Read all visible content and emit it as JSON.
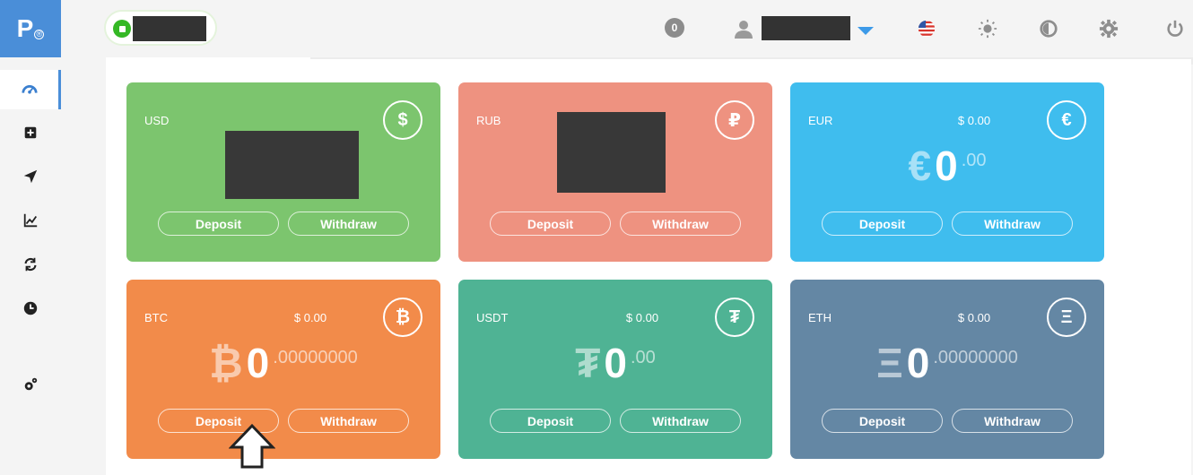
{
  "logo": {
    "letter": "P",
    "mark": "®"
  },
  "sidebar": {
    "items": [
      {
        "name": "dashboard",
        "icon": "gauge-icon",
        "active": true
      },
      {
        "name": "add",
        "icon": "plus-square-icon",
        "active": false
      },
      {
        "name": "send",
        "icon": "paper-plane-icon",
        "active": false
      },
      {
        "name": "stats",
        "icon": "line-chart-icon",
        "active": false
      },
      {
        "name": "exchange",
        "icon": "refresh-icon",
        "active": false
      },
      {
        "name": "history",
        "icon": "clock-icon",
        "active": false
      },
      {
        "name": "settings",
        "icon": "cogs-icon",
        "active": false
      }
    ]
  },
  "header": {
    "notification_count": "0",
    "icons": [
      "us-flag-icon",
      "sun-icon",
      "theme-icon",
      "gear-icon",
      "power-icon"
    ]
  },
  "cards": [
    {
      "currency": "USD",
      "usd_value": "",
      "symbol": "$",
      "amount_int": "",
      "amount_dec": "",
      "color": "#7cc56e",
      "deposit": "Deposit",
      "withdraw": "Withdraw",
      "redacted": true
    },
    {
      "currency": "RUB",
      "usd_value": "",
      "symbol": "₽",
      "amount_int": "",
      "amount_dec": "",
      "color": "#ee9280",
      "deposit": "Deposit",
      "withdraw": "Withdraw",
      "redacted": true
    },
    {
      "currency": "EUR",
      "usd_value": "$ 0.00",
      "symbol": "€",
      "amount_int": "0",
      "amount_dec": ".00",
      "color": "#3fbdee",
      "deposit": "Deposit",
      "withdraw": "Withdraw"
    },
    {
      "currency": "BTC",
      "usd_value": "$ 0.00",
      "symbol": "₿",
      "amount_int": "0",
      "amount_dec": ".00000000",
      "color": "#f28b4a",
      "deposit": "Deposit",
      "withdraw": "Withdraw"
    },
    {
      "currency": "USDT",
      "usd_value": "$ 0.00",
      "symbol": "₮",
      "amount_int": "0",
      "amount_dec": ".00",
      "color": "#4fb394",
      "deposit": "Deposit",
      "withdraw": "Withdraw"
    },
    {
      "currency": "ETH",
      "usd_value": "$ 0.00",
      "symbol": "Ξ",
      "amount_int": "0",
      "amount_dec": ".00000000",
      "color": "#6487a4",
      "deposit": "Deposit",
      "withdraw": "Withdraw"
    }
  ]
}
